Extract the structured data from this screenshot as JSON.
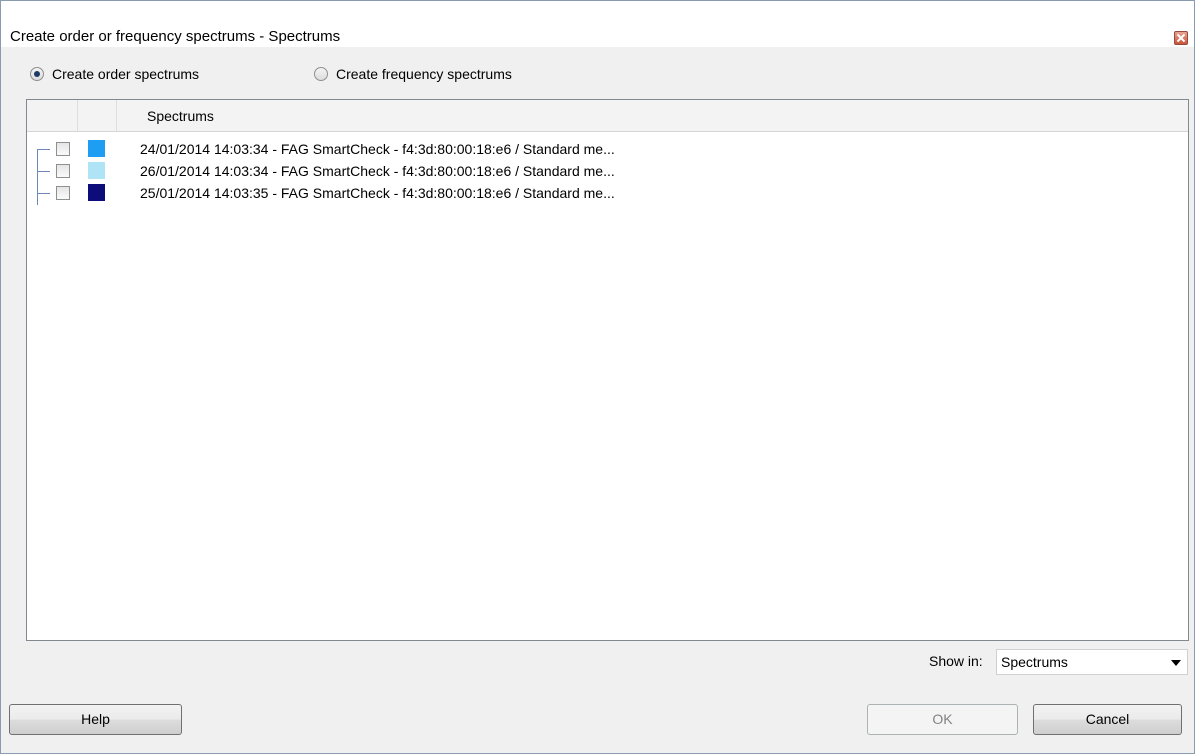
{
  "window": {
    "title": "Create order or frequency spectrums - Spectrums"
  },
  "mode": {
    "order_label": "Create order spectrums",
    "frequency_label": "Create frequency spectrums",
    "selected": "order"
  },
  "grid": {
    "column_header": "Spectrums",
    "rows": [
      {
        "label": "24/01/2014 14:03:34 - FAG SmartCheck - f4:3d:80:00:18:e6 / Standard me...",
        "color": "#1e9ef2",
        "checked": false
      },
      {
        "label": "26/01/2014 14:03:34 - FAG SmartCheck - f4:3d:80:00:18:e6 / Standard me...",
        "color": "#aee4f6",
        "checked": false
      },
      {
        "label": "25/01/2014 14:03:35 - FAG SmartCheck - f4:3d:80:00:18:e6 / Standard me...",
        "color": "#0c0c7a",
        "checked": false
      }
    ]
  },
  "show_in": {
    "label": "Show in:",
    "value": "Spectrums"
  },
  "buttons": {
    "help": "Help",
    "ok": "OK",
    "cancel": "Cancel"
  }
}
